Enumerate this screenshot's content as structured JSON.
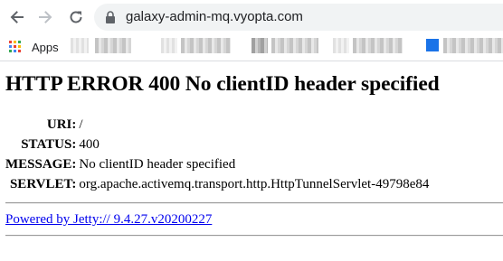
{
  "browser": {
    "url": "galaxy-admin-mq.vyopta.com",
    "icons": [
      "back-arrow-icon",
      "forward-arrow-icon",
      "reload-icon",
      "lock-icon",
      "apps-grid-icon"
    ],
    "bookmarks": {
      "apps_label": "Apps"
    },
    "colors": {
      "chrome_bg": "#ffffff",
      "omnibox_bg": "#f1f3f4",
      "link": "#0000ee"
    }
  },
  "error_page": {
    "heading": "HTTP ERROR 400 No clientID header specified",
    "rows": [
      {
        "label": "URI:",
        "value": "/"
      },
      {
        "label": "STATUS:",
        "value": "400"
      },
      {
        "label": "MESSAGE:",
        "value": "No clientID header specified"
      },
      {
        "label": "SERVLET:",
        "value": "org.apache.activemq.transport.http.HttpTunnelServlet-49798e84"
      }
    ],
    "powered_by": "Powered by Jetty:// 9.4.27.v20200227"
  }
}
